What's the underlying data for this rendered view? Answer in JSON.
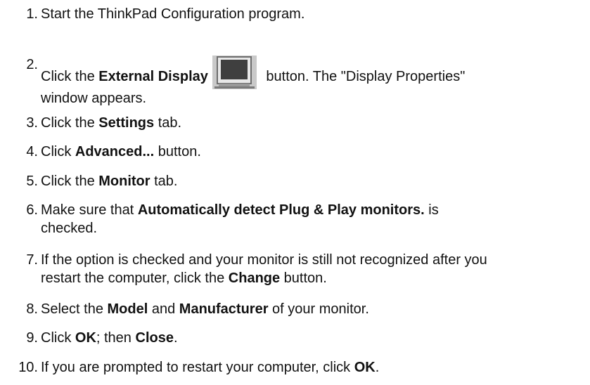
{
  "steps": [
    {
      "num": "1.",
      "t1": "Start the ThinkPad Configuration program."
    },
    {
      "num": "2.",
      "t1": "Click the ",
      "b1": "External Display",
      "t2": " button. The \"Display Properties\"",
      "t3": "window appears.",
      "icon": "monitor-icon"
    },
    {
      "num": "3.",
      "t1": "Click the ",
      "b1": "Settings",
      "t2": " tab."
    },
    {
      "num": "4.",
      "t1": "Click ",
      "b1": "Advanced...",
      "t2": " button."
    },
    {
      "num": "5.",
      "t1": "Click the ",
      "b1": "Monitor",
      "t2": " tab."
    },
    {
      "num": "6.",
      "t1": "Make sure that ",
      "b1": "Automatically detect Plug & Play monitors.",
      "t2": "  is",
      "t3": "checked."
    },
    {
      "num": "7.",
      "t1": "If the option is checked and your monitor is still not recognized after you",
      "t2": "restart the computer, click the ",
      "b1": "Change",
      "t3": " button."
    },
    {
      "num": "8.",
      "t1": "Select the ",
      "b1": "Model",
      "t2": " and ",
      "b2": "Manufacturer",
      "t3": " of your monitor."
    },
    {
      "num": "9.",
      "t1": "Click ",
      "b1": "OK",
      "t2": "; then ",
      "b2": "Close",
      "t3": "."
    },
    {
      "num": "10.",
      "t1": "If you are prompted to restart your computer, click ",
      "b1": "OK",
      "t2": "."
    }
  ]
}
